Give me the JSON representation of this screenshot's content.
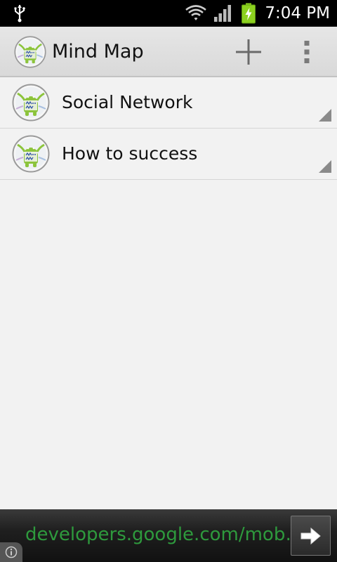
{
  "status_bar": {
    "time": "7:04 PM",
    "icons": [
      "usb-icon",
      "wifi-icon",
      "signal-icon",
      "battery-charging-icon"
    ]
  },
  "action_bar": {
    "title": "Mind Map",
    "app_icon": "mind-map-logo-icon",
    "actions": [
      "add-icon",
      "overflow-menu-icon"
    ]
  },
  "mind_maps": [
    {
      "name": "Social Network",
      "icon": "mind-map-logo-icon"
    },
    {
      "name": "How to success",
      "icon": "mind-map-logo-icon"
    }
  ],
  "ad_banner": {
    "text": "developers.google.com/mob…",
    "text_color": "#2e9a3d",
    "arrow_icon": "arrow-right-icon",
    "info_icon": "info-icon"
  },
  "colors": {
    "background": "#f2f2f2",
    "action_bar": "#e0e0e0",
    "status_bar": "#000000",
    "battery": "#8cd11f"
  }
}
